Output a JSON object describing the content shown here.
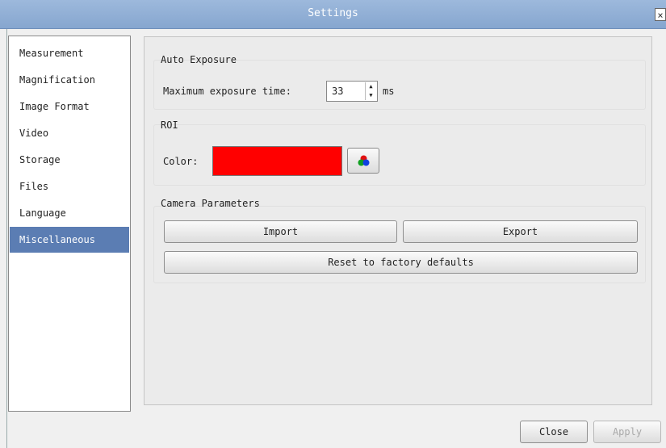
{
  "window": {
    "title": "Settings",
    "close_glyph": "×"
  },
  "nav": {
    "items": [
      {
        "label": "Measurement"
      },
      {
        "label": "Magnification"
      },
      {
        "label": "Image Format"
      },
      {
        "label": "Video"
      },
      {
        "label": "Storage"
      },
      {
        "label": "Files"
      },
      {
        "label": "Language"
      },
      {
        "label": "Miscellaneous",
        "selected": true
      }
    ]
  },
  "auto_exposure": {
    "title": "Auto Exposure",
    "max_label": "Maximum exposure time:",
    "value": "33",
    "unit": "ms"
  },
  "roi": {
    "title": "ROI",
    "color_label": "Color:",
    "color_value": "#ff0000"
  },
  "camera": {
    "title": "Camera Parameters",
    "import_label": "Import",
    "export_label": "Export",
    "reset_label": "Reset to factory defaults"
  },
  "footer": {
    "close_label": "Close",
    "apply_label": "Apply"
  },
  "colors": {
    "titlebar": "#8fadd5",
    "selection": "#5b7db3",
    "roi_swatch": "#ff0000"
  }
}
